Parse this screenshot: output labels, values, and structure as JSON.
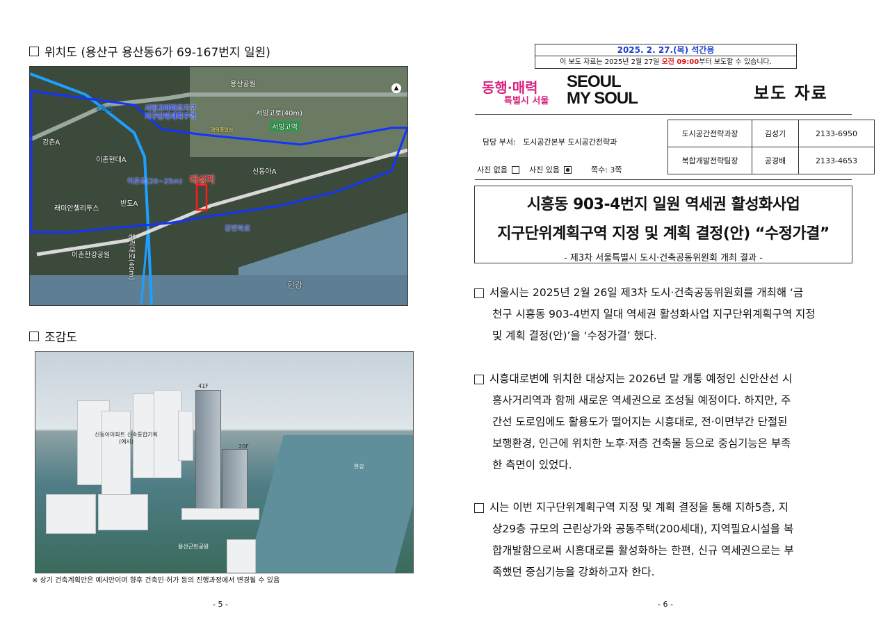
{
  "left_page": {
    "location_title": "위치도 (용산구 용산동6가 69-167번지 일원)",
    "map_labels": {
      "park": "용산공원",
      "district": "서빙고아파트지구\n지구단위계획구역",
      "road_seobinggo": "서빙고로(40m)",
      "station": "서빙고역",
      "rail": "경의중앙선",
      "line4": "4호선",
      "apt_gangchon": "강촌A",
      "apt_ichon_hyundai": "이촌현대A",
      "road_ichon": "이촌로(20~25m)",
      "target": "대상지",
      "apt_sindong": "신동아A",
      "apt_ban": "반도A",
      "apt_raemian": "래미안첼리투스",
      "road_dongjak": "동작대로(40m)",
      "road_gangbyeon": "강변북로",
      "park_ichon": "이촌한강공원",
      "river": "한강"
    },
    "birdseye_title": "조감도",
    "render_labels": {
      "floor41": "41F",
      "floor20": "20F",
      "sindong_plan": "신동아아파트 신속통합기획\n(예시)",
      "river": "한강",
      "park": "용산근린공원"
    },
    "note": "※ 상기 건축계획안은 예시안이며 향후 건축인·허가 등의 진행과정에서 변경될 수 있음",
    "page_number": "- 5 -"
  },
  "right_page": {
    "date_line": "2025. 2. 27.(목) 석간용",
    "embargo_prefix": "이 보도 자료는 2025년 2월 27일 ",
    "embargo_time": "오전 09:00",
    "embargo_suffix": "부터 보도할 수 있습니다.",
    "logo_slogan": "동행·매력",
    "logo_slogan_sub": "특별시 서울",
    "logo_seoul_1": "SEOUL",
    "logo_seoul_2": "MY SOUL",
    "press_title": "보도 자료",
    "dept_label": "담당 부서:",
    "dept_value": "도시공간본부 도시공간전략과",
    "photo_none": "사진 없음",
    "photo_yes": "사진 있음",
    "pages": "쪽수: 3쪽",
    "contacts": [
      {
        "position": "도시공간전략과장",
        "name": "김성기",
        "phone": "2133-6950"
      },
      {
        "position": "복합개발전략팀장",
        "name": "공경배",
        "phone": "2133-4653"
      }
    ],
    "headline_1": "시흥동 903-4번지 일원 역세권 활성화사업",
    "headline_2": "지구단위계획구역 지정 및 계획 결정(안) “수정가결”",
    "subheadline": "- 제3차 서울특별시 도시·건축공동위원회 개최 결과 -",
    "paragraphs": [
      {
        "first": "서울시는 2025년 2월 26일 제3차 도시·건축공동위원회를 개최해 ‘금",
        "rest": [
          "천구 시흥동 903-4번지 일대 역세권 활성화사업 지구단위계획구역 지정",
          "및 계획 결정(안)’을 ‘수정가결’ 했다."
        ]
      },
      {
        "first": "시흥대로변에 위치한 대상지는 2026년 말 개통 예정인 신안산선 시",
        "rest": [
          "흥사거리역과 함께 새로운 역세권으로 조성될 예정이다. 하지만, 주",
          "간선 도로임에도 활용도가 떨어지는 시흥대로, 전·이면부간 단절된",
          "보행환경, 인근에 위치한 노후·저층 건축물 등으로 중심기능은 부족",
          "한 측면이 있었다."
        ]
      },
      {
        "first": "시는 이번 지구단위계획구역 지정 및 계획 결정을 통해 지하5층, 지",
        "rest": [
          "상29층 규모의 근린상가와 공동주택(200세대), 지역필요시설을 복",
          "합개발함으로써 시흥대로를 활성화하는 한편, 신규 역세권으로는 부",
          "족했던 중심기능을 강화하고자 한다."
        ]
      }
    ],
    "page_number": "- 6 -"
  }
}
